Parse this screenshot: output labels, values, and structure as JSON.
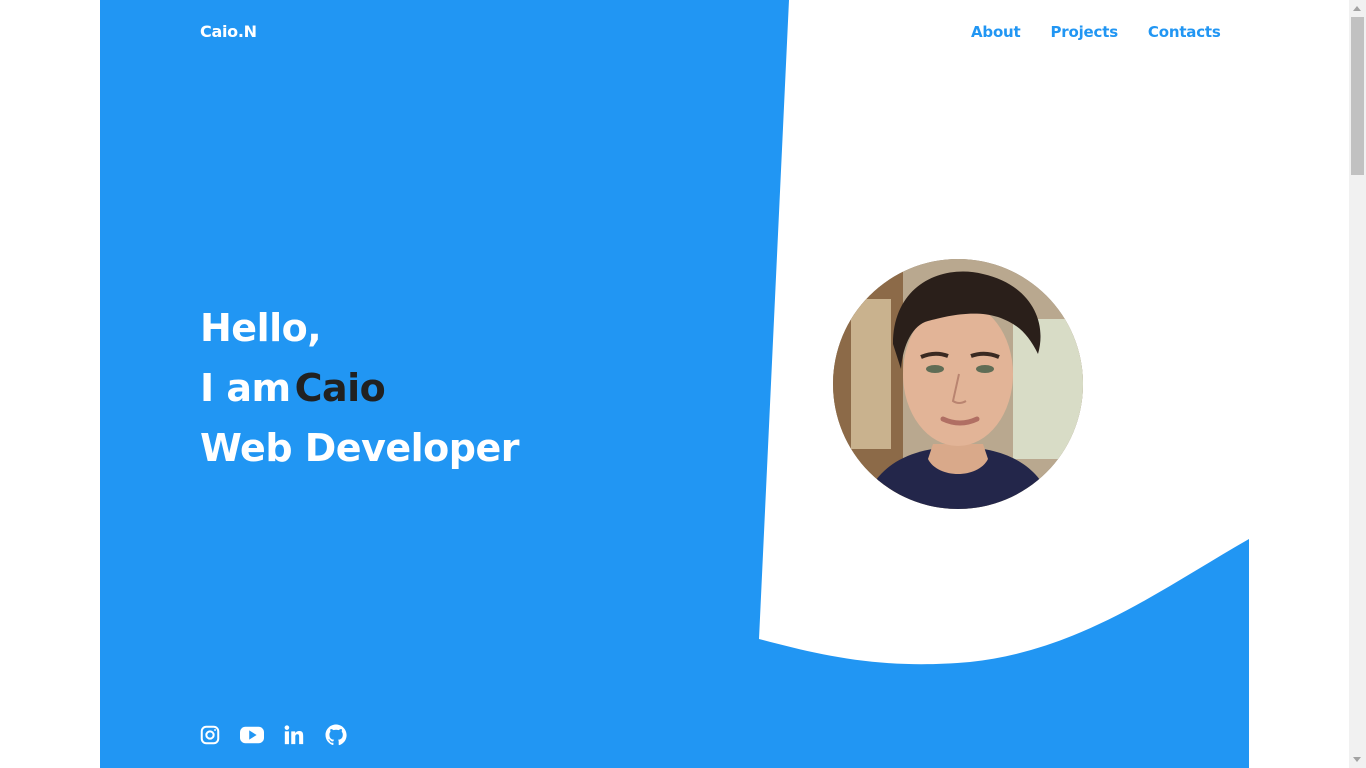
{
  "brand": {
    "logo": "Caio.N"
  },
  "nav": {
    "items": [
      {
        "label": "About"
      },
      {
        "label": "Projects"
      },
      {
        "label": "Contacts"
      }
    ]
  },
  "hero": {
    "line1": "Hello,",
    "line2_prefix": "I am",
    "line2_name": "Caio",
    "line3": "Web Developer"
  },
  "avatar": {
    "alt": "Portrait photo of Caio"
  },
  "socials": [
    {
      "icon": "instagram-icon"
    },
    {
      "icon": "youtube-icon"
    },
    {
      "icon": "linkedin-icon"
    },
    {
      "icon": "github-icon"
    }
  ],
  "colors": {
    "primary": "#2196f3",
    "white": "#ffffff",
    "name_accent": "#212121"
  }
}
